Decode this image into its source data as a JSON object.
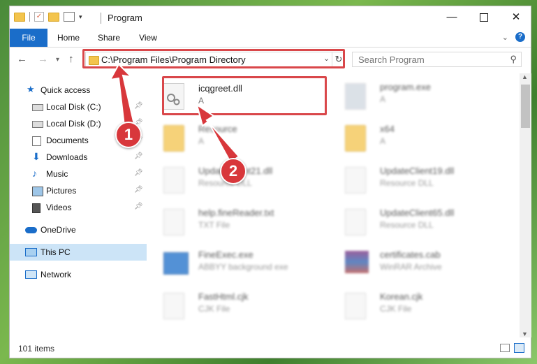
{
  "window": {
    "title": "Program",
    "controls": {
      "minimize": "—",
      "maximize": "",
      "close": "✕"
    }
  },
  "ribbon": {
    "tabs": [
      {
        "label": "File"
      },
      {
        "label": "Home"
      },
      {
        "label": "Share"
      },
      {
        "label": "View"
      }
    ]
  },
  "address_bar": {
    "path": "C:\\Program Files\\Program Directory"
  },
  "search": {
    "placeholder": "Search Program"
  },
  "sidebar": {
    "items": [
      {
        "label": "Quick access",
        "icon": "star-icon",
        "pinned": false
      },
      {
        "label": "Local Disk (C:)",
        "icon": "drive-icon",
        "pinned": true
      },
      {
        "label": "Local Disk (D:)",
        "icon": "drive-icon",
        "pinned": true
      },
      {
        "label": "Documents",
        "icon": "documents-icon",
        "pinned": true
      },
      {
        "label": "Downloads",
        "icon": "download-icon",
        "pinned": true
      },
      {
        "label": "Music",
        "icon": "music-icon",
        "pinned": true
      },
      {
        "label": "Pictures",
        "icon": "pictures-icon",
        "pinned": true
      },
      {
        "label": "Videos",
        "icon": "videos-icon",
        "pinned": true
      },
      {
        "label": "OneDrive",
        "icon": "cloud-icon",
        "pinned": false
      },
      {
        "label": "This PC",
        "icon": "computer-icon",
        "pinned": false,
        "selected": true
      },
      {
        "label": "Network",
        "icon": "network-icon",
        "pinned": false
      }
    ]
  },
  "files": [
    {
      "name": "icqgreet.dll",
      "type": "A",
      "icon": "dll-file-icon",
      "highlighted": true
    },
    {
      "name": "program.exe",
      "type": "A",
      "icon": "exe-file-icon"
    },
    {
      "name": "Resource",
      "type": "A",
      "icon": "folder-icon"
    },
    {
      "name": "x64",
      "type": "A",
      "icon": "folder-icon"
    },
    {
      "name": "UpdateClient21.dll",
      "type": "Resource DLL",
      "icon": "dll-file-icon"
    },
    {
      "name": "UpdateClient19.dll",
      "type": "Resource DLL",
      "icon": "dll-file-icon"
    },
    {
      "name": "help.fineReader.txt",
      "type": "TXT File",
      "icon": "text-file-icon"
    },
    {
      "name": "UpdateClient65.dll",
      "type": "Resource DLL",
      "icon": "dll-file-icon"
    },
    {
      "name": "FineExec.exe",
      "type": "ABBYY background exe",
      "icon": "exe-file-icon"
    },
    {
      "name": "certificates.cab",
      "type": "WinRAR Archive",
      "icon": "archive-icon"
    },
    {
      "name": "FastHtml.cjk",
      "type": "CJK File",
      "icon": "generic-file-icon"
    },
    {
      "name": "Korean.cjk",
      "type": "CJK File",
      "icon": "generic-file-icon"
    }
  ],
  "status": {
    "item_count": "101 items"
  },
  "callouts": [
    {
      "number": "1"
    },
    {
      "number": "2"
    }
  ],
  "colors": {
    "accent": "#1a6dc9",
    "highlight_red": "#d9474a",
    "selection": "#cce4f7"
  }
}
